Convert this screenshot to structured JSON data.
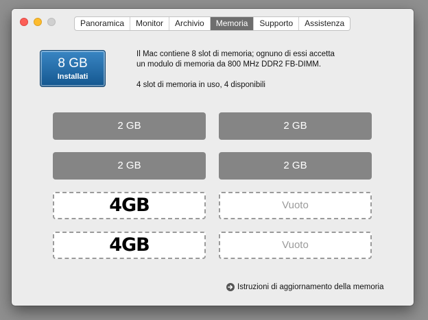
{
  "tabs": [
    {
      "label": "Panoramica",
      "active": false
    },
    {
      "label": "Monitor",
      "active": false
    },
    {
      "label": "Archivio",
      "active": false
    },
    {
      "label": "Memoria",
      "active": true
    },
    {
      "label": "Supporto",
      "active": false
    },
    {
      "label": "Assistenza",
      "active": false
    }
  ],
  "badge": {
    "amount": "8 GB",
    "label": "Installati"
  },
  "description": {
    "line1": "Il Mac contiene 8 slot di memoria; ognuno di essi accetta",
    "line2": "un modulo di memoria da 800 MHz DDR2 FB-DIMM.",
    "line3": "4 slot di memoria in uso, 4 disponibili"
  },
  "slots": [
    {
      "label": "2 GB",
      "state": "filled"
    },
    {
      "label": "2 GB",
      "state": "filled"
    },
    {
      "label": "2 GB",
      "state": "filled"
    },
    {
      "label": "2 GB",
      "state": "filled"
    },
    {
      "label": "4GB",
      "state": "big"
    },
    {
      "label": "Vuoto",
      "state": "empty"
    },
    {
      "label": "4GB",
      "state": "big"
    },
    {
      "label": "Vuoto",
      "state": "empty"
    }
  ],
  "footer": {
    "link_label": "Istruzioni di aggiornamento della memoria"
  },
  "colors": {
    "badge": "#1f6aa8",
    "slot_filled": "#858585",
    "active_tab": "#6e6e6e"
  }
}
